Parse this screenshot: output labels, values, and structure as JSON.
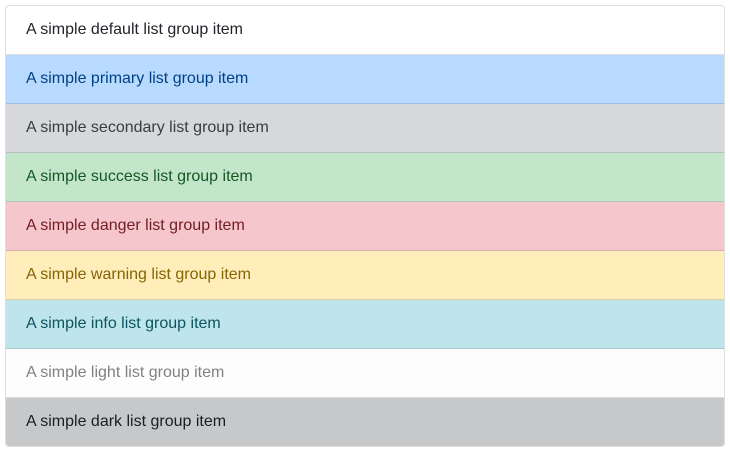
{
  "list_group": {
    "items": [
      {
        "label": "A simple default list group item",
        "variant": "default",
        "background": "#ffffff",
        "color": "#212529"
      },
      {
        "label": "A simple primary list group item",
        "variant": "primary",
        "background": "#b8daff",
        "color": "#004085"
      },
      {
        "label": "A simple secondary list group item",
        "variant": "secondary",
        "background": "#d6d8db",
        "color": "#383d41"
      },
      {
        "label": "A simple success list group item",
        "variant": "success",
        "background": "#c3e6cb",
        "color": "#155724"
      },
      {
        "label": "A simple danger list group item",
        "variant": "danger",
        "background": "#f5c6cb",
        "color": "#721c24"
      },
      {
        "label": "A simple warning list group item",
        "variant": "warning",
        "background": "#ffeeba",
        "color": "#856404"
      },
      {
        "label": "A simple info list group item",
        "variant": "info",
        "background": "#bee5eb",
        "color": "#0c5460"
      },
      {
        "label": "A simple light list group item",
        "variant": "light",
        "background": "#fdfdfe",
        "color": "#818182"
      },
      {
        "label": "A simple dark list group item",
        "variant": "dark",
        "background": "#c6c8ca",
        "color": "#1b1e21"
      }
    ]
  }
}
